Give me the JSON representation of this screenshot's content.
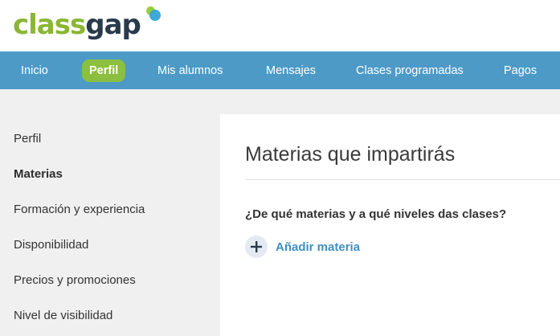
{
  "brand": {
    "logo_part1": "class",
    "logo_part2": "gap"
  },
  "nav": {
    "items": [
      {
        "label": "Inicio"
      },
      {
        "label": "Perfil",
        "active": true
      },
      {
        "label": "Mis alumnos"
      },
      {
        "label": "Mensajes"
      },
      {
        "label": "Clases programadas"
      },
      {
        "label": "Pagos"
      }
    ]
  },
  "sidebar": {
    "items": [
      {
        "label": "Perfil"
      },
      {
        "label": "Materias",
        "active": true
      },
      {
        "label": "Formación y experiencia"
      },
      {
        "label": "Disponibilidad"
      },
      {
        "label": "Precios y promociones"
      },
      {
        "label": "Nivel de visibilidad"
      }
    ]
  },
  "main": {
    "title": "Materias que impartirás",
    "question": "¿De qué materias y a qué niveles das clases?",
    "add_label": "Añadir materia",
    "add_icon": "plus-icon"
  },
  "colors": {
    "nav_bg": "#4d9ac7",
    "active_pill": "#8cbf3f",
    "link": "#3f8fc2",
    "logo_green": "#8bb634",
    "logo_dark": "#2a3a4c"
  }
}
